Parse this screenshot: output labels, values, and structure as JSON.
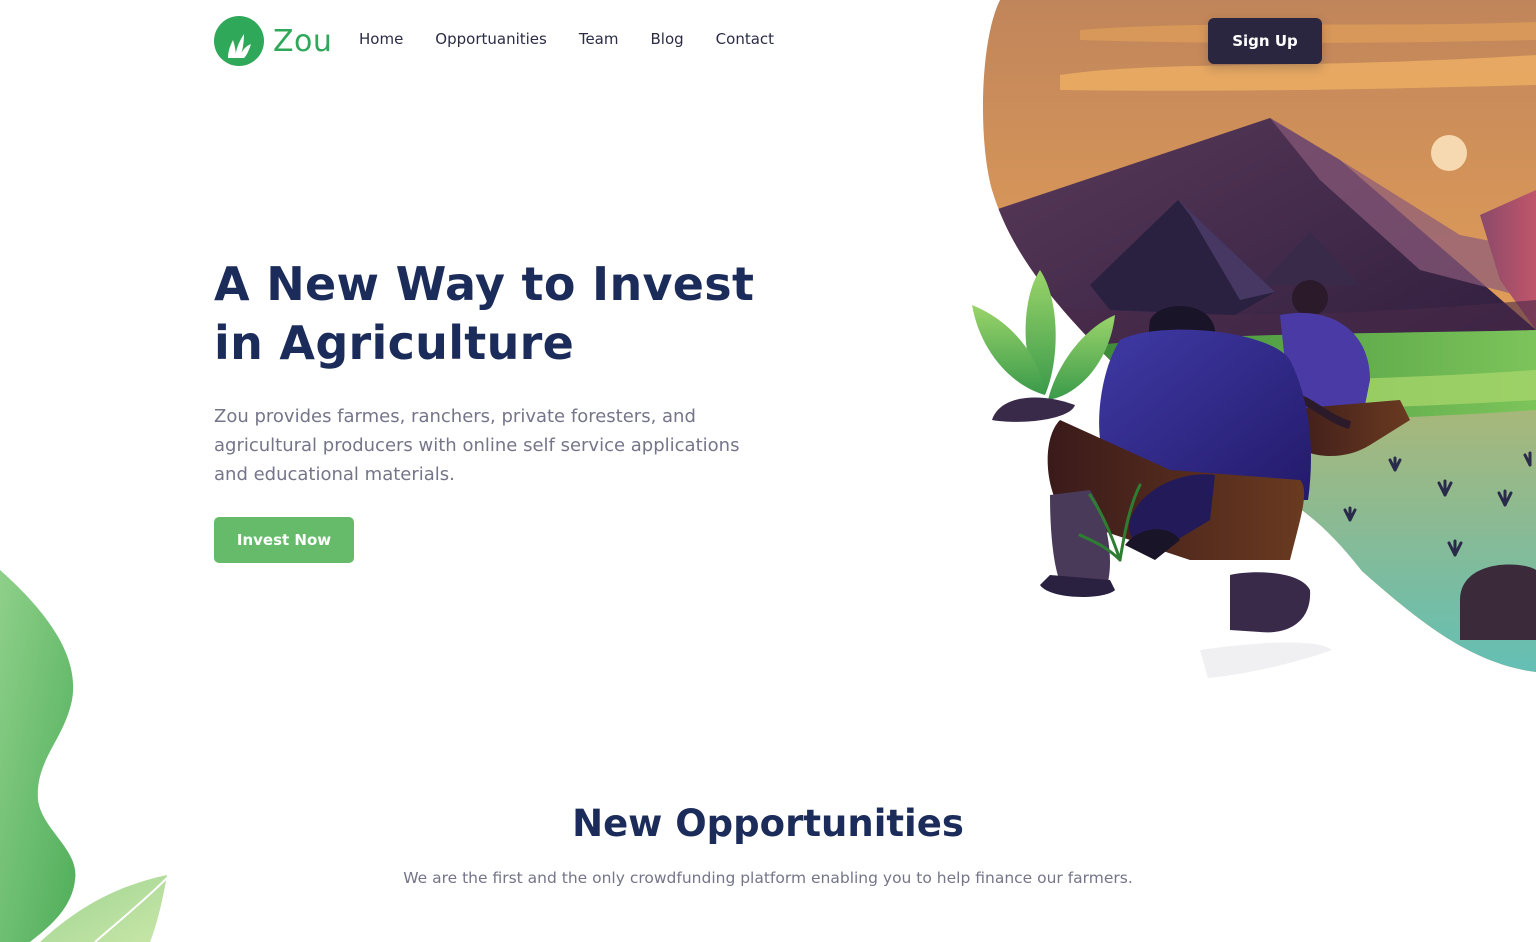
{
  "brand": {
    "name": "Zou",
    "color": "#2fa85a"
  },
  "nav": {
    "links": [
      "Home",
      "Opportuanities",
      "Team",
      "Blog",
      "Contact"
    ],
    "signup_label": "Sign Up"
  },
  "hero": {
    "title_line1": "A New Way to Invest",
    "title_line2": "in Agriculture",
    "description": "Zou provides farmes, ranchers, private foresters, and agricultural producers with online self service applications and educational materials.",
    "cta_label": "Invest Now"
  },
  "section": {
    "title": "New Opportunities",
    "subtitle": "We are the first and the only crowdfunding platform enabling you to help finance our farmers."
  },
  "colors": {
    "primary_dark": "#2b2640",
    "heading": "#1b2c5a",
    "body_text": "#75758a",
    "accent_green": "#66bb6a"
  }
}
